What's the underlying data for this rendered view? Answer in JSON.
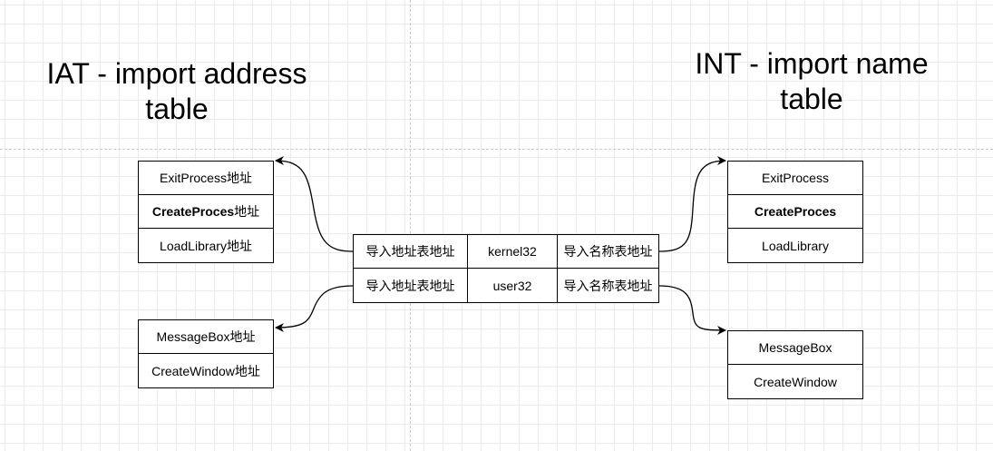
{
  "iat_title": [
    "IAT - import  address",
    "table"
  ],
  "int_title": [
    "INT - import name",
    "table"
  ],
  "iat_kernel32": [
    {
      "text": "ExitProcess",
      "suffix": "地址",
      "bold": false
    },
    {
      "text": "CreateProces",
      "suffix": "地址",
      "bold": true
    },
    {
      "text": "LoadLibrary",
      "suffix": "地址",
      "bold": false
    }
  ],
  "iat_user32": [
    {
      "text": "MessageBox",
      "suffix": "地址",
      "bold": false
    },
    {
      "text": "CreateWindow",
      "suffix": "地址",
      "bold": false
    }
  ],
  "descriptors": [
    {
      "iat_ref": "导入地址表地址",
      "dll": "kernel32",
      "int_ref": "导入名称表地址"
    },
    {
      "iat_ref": "导入地址表地址",
      "dll": "user32",
      "int_ref": "导入名称表地址"
    }
  ],
  "int_kernel32": [
    {
      "text": "ExitProcess",
      "bold": false
    },
    {
      "text": "CreateProces",
      "bold": true
    },
    {
      "text": "LoadLibrary",
      "bold": false
    }
  ],
  "int_user32": [
    {
      "text": "MessageBox",
      "bold": false
    },
    {
      "text": "CreateWindow",
      "bold": false
    }
  ]
}
